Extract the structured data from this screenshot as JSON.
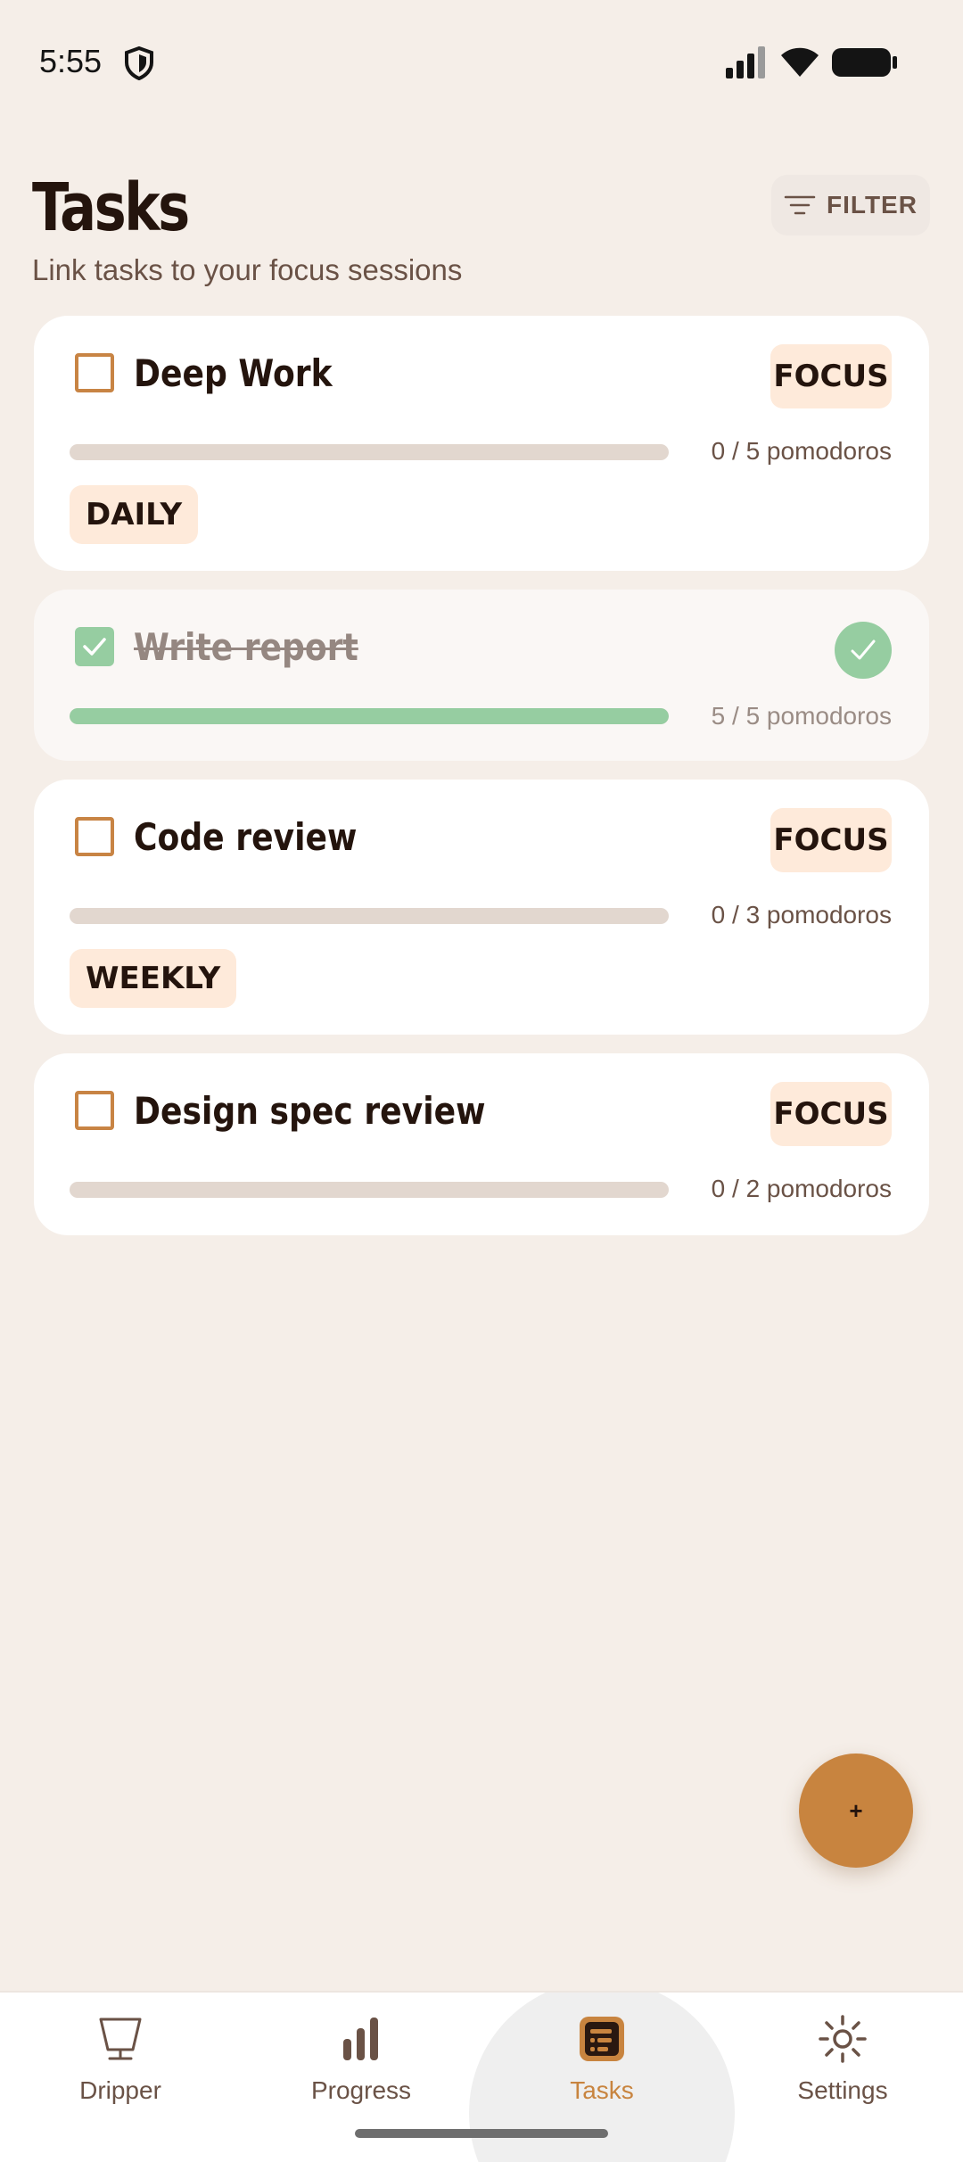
{
  "status_bar": {
    "time": "5:55",
    "icons": [
      "shield-icon",
      "signal-icon",
      "wifi-icon",
      "battery-icon"
    ]
  },
  "header": {
    "title": "Tasks",
    "subtitle": "Link tasks to your focus sessions",
    "filter_label": "FILTER",
    "filter_icon": "filter-lines-icon"
  },
  "tasks": [
    {
      "title": "Deep Work",
      "tag": "FOCUS",
      "recurrence": "DAILY",
      "progress_text": "0 / 5 pomodoros",
      "completed": 0,
      "total": 5,
      "done": false
    },
    {
      "title": "Write report",
      "progress_text": "5 / 5 pomodoros",
      "completed": 5,
      "total": 5,
      "done": true
    },
    {
      "title": "Code review",
      "tag": "FOCUS",
      "recurrence": "WEEKLY",
      "progress_text": "0 / 3 pomodoros",
      "completed": 0,
      "total": 3,
      "done": false
    },
    {
      "title": "Design spec review",
      "tag": "FOCUS",
      "progress_text": "0 / 2 pomodoros",
      "completed": 0,
      "total": 2,
      "done": false
    }
  ],
  "fab": {
    "label": "+"
  },
  "nav": {
    "items": [
      {
        "label": "Dripper",
        "icon": "dripper-icon",
        "active": false
      },
      {
        "label": "Progress",
        "icon": "bar-chart-icon",
        "active": false
      },
      {
        "label": "Tasks",
        "icon": "tasks-icon",
        "active": true
      },
      {
        "label": "Settings",
        "icon": "gear-icon",
        "active": false
      }
    ]
  },
  "colors": {
    "background": "#F5EEE8",
    "accent": "#C8843F",
    "success": "#96CDA1",
    "tag_bg": "#FEEADA",
    "text_primary": "#24140D",
    "text_secondary": "#6A5246"
  }
}
